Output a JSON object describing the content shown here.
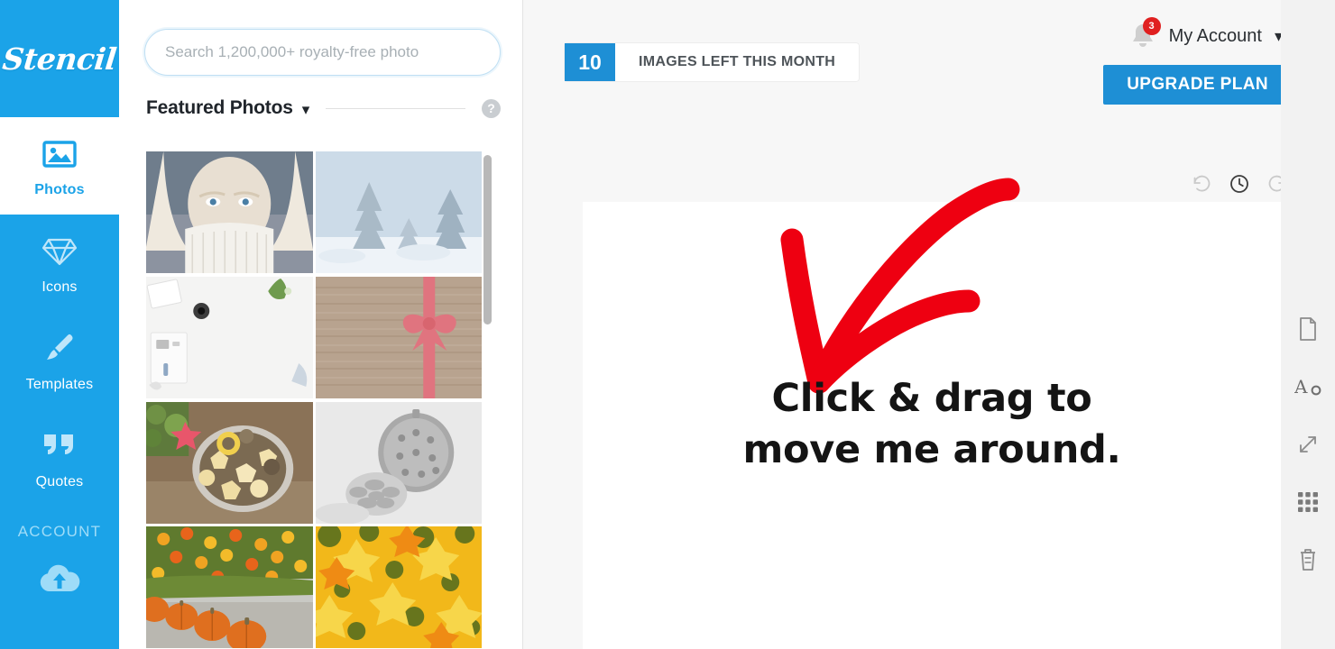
{
  "app": {
    "logo": "Stencil"
  },
  "sidebar": {
    "items": [
      {
        "label": "Photos",
        "icon": "image-icon",
        "active": true
      },
      {
        "label": "Icons",
        "icon": "diamond-icon",
        "active": false
      },
      {
        "label": "Templates",
        "icon": "brush-icon",
        "active": false
      },
      {
        "label": "Quotes",
        "icon": "quote-icon",
        "active": false
      }
    ],
    "account_section_label": "ACCOUNT",
    "account_upload_icon": "cloud-upload-icon"
  },
  "panel": {
    "search": {
      "placeholder": "Search 1,200,000+ royalty-free photo",
      "value": ""
    },
    "section_title": "Featured Photos",
    "caret_icon": "chevron-down-icon",
    "help_icon": "help-circle-icon",
    "help_label": "?",
    "thumbnails": [
      {
        "name": "woman-in-white-knit-sweater-snow"
      },
      {
        "name": "snow-covered-pine-trees"
      },
      {
        "name": "white-desk-flatlay-with-mistletoe"
      },
      {
        "name": "pink-ribbon-bow-on-wood"
      },
      {
        "name": "christmas-cookies-in-bowl"
      },
      {
        "name": "silver-pinecone-and-ornament"
      },
      {
        "name": "row-of-orange-pumpkins-and-marigolds"
      },
      {
        "name": "yellow-autumn-maple-leaves"
      }
    ]
  },
  "topbar": {
    "quota_count": "10",
    "quota_text": "IMAGES LEFT THIS MONTH",
    "bell_icon": "notification-bell-icon",
    "bell_badge": "3",
    "account_name": "My Account",
    "account_caret_icon": "chevron-down-icon",
    "upgrade_label": "UPGRADE PLAN"
  },
  "history_tools": [
    {
      "name": "undo-icon",
      "label": "Undo"
    },
    {
      "name": "history-icon",
      "label": "History"
    },
    {
      "name": "redo-icon",
      "label": "Redo"
    }
  ],
  "canvas": {
    "text_line_1": "Click & drag to",
    "text_line_2": "move me around.",
    "annotation": "red-checkmark-arrow",
    "annotation_color": "#ee0011"
  },
  "right_rail": [
    {
      "name": "page-icon",
      "label": "Canvas size"
    },
    {
      "name": "text-icon",
      "label": "Text"
    },
    {
      "name": "resize-icon",
      "label": "Resize"
    },
    {
      "name": "grid-icon",
      "label": "Grid"
    },
    {
      "name": "trash-icon",
      "label": "Delete"
    }
  ],
  "colors": {
    "brand_blue": "#1ba3e8",
    "button_blue": "#1e8fd5",
    "badge_red": "#e02020",
    "annotation_red": "#ee0011",
    "main_bg": "#f7f7f7",
    "rail_bg": "#f2f2f2"
  }
}
